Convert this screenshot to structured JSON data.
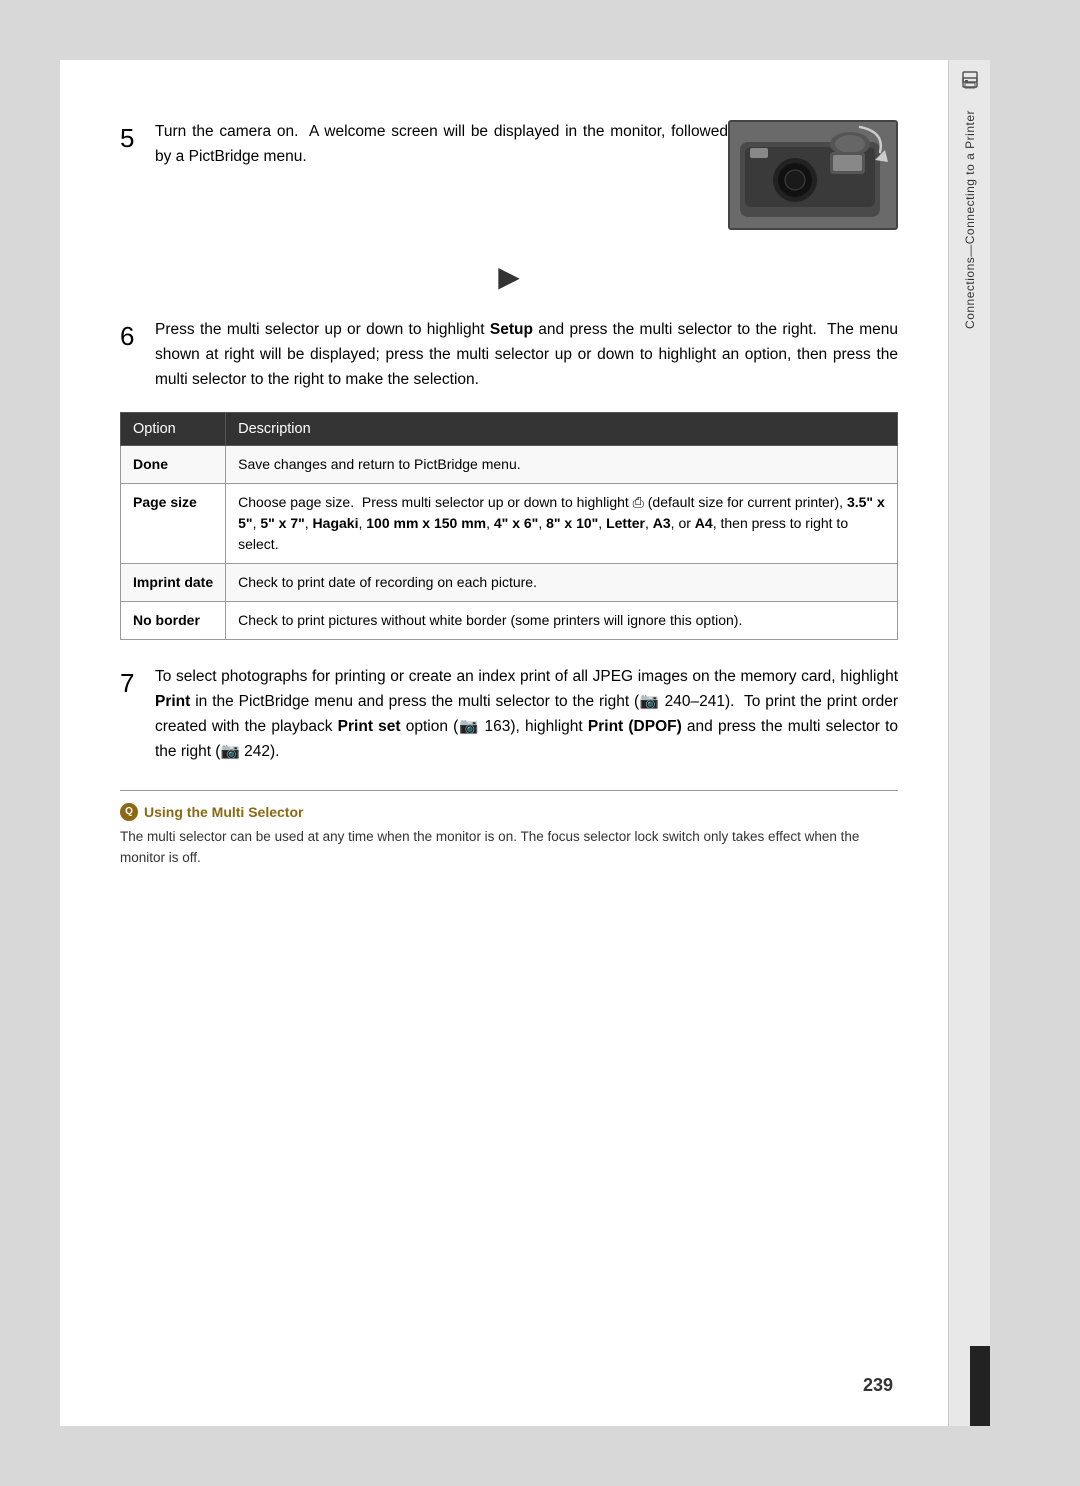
{
  "page": {
    "number": "239",
    "background": "#d8d8d8"
  },
  "sidebar": {
    "icon_label": "printer-icon",
    "text": "Connections—Connecting to a Printer"
  },
  "step5": {
    "number": "5",
    "text": "Turn the camera on.  A welcome screen will be displayed in the monitor, followed by a PictBridge menu."
  },
  "arrow_divider": "▶",
  "step6": {
    "number": "6",
    "text": "Press the multi selector up or down to highlight ",
    "bold": "Setup",
    "text2": " and press the multi selector to the right.  The menu shown at right will be displayed; press the multi selector up or down to highlight an option, then press the multi selector to the right to make the selection."
  },
  "table": {
    "headers": [
      "Option",
      "Description"
    ],
    "rows": [
      {
        "option": "Done",
        "option_bold": true,
        "description": "Save changes and return to PictBridge menu."
      },
      {
        "option": "Page size",
        "option_bold": true,
        "description": "Choose page size.  Press multi selector up or down to highlight  (default size for current printer),  3.5\" x 5\",  5\" x 7\", Hagaki,  100 mm x 150 mm,  4\" x 6\",  8\" x 10\", Letter, A3, or A4, then press to right to select."
      },
      {
        "option": "Imprint date",
        "option_bold": true,
        "description": "Check to print date of recording on each picture."
      },
      {
        "option": "No border",
        "option_bold": true,
        "description": "Check to print pictures without white border (some printers will ignore this option)."
      }
    ]
  },
  "step7": {
    "number": "7",
    "text_parts": [
      "To select photographs for printing or create an index print of all JPEG images on the memory card, highlight ",
      "Print",
      " in the PictBridge menu and press the multi selector to the right (",
      " 240–241).  To print the print order created with the playback ",
      "Print set",
      " option (",
      " 163), highlight ",
      "Print (DPOF)",
      " and press the multi selector to the right (",
      " 242)."
    ]
  },
  "tip": {
    "icon": "Q",
    "title": "Using the Multi Selector",
    "text": "The multi selector can be used at any time when the monitor is on.  The focus selector lock switch only takes effect when the monitor is off."
  },
  "table_page_size_desc_bold_parts": [
    "3.5\" x 5\"",
    "5\" x 7\"",
    "Hagaki",
    "100 mm x 150 mm",
    "4\" x 6\"",
    "8\" x 10\"",
    "Letter",
    "A3",
    "A4"
  ]
}
